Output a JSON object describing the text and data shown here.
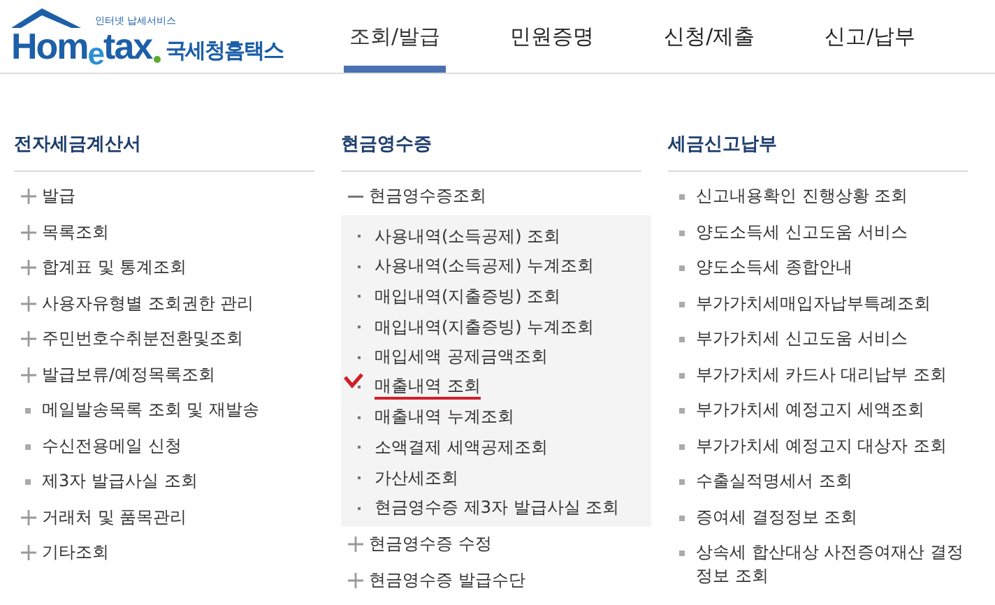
{
  "logo": {
    "tagline": "인터넷 납세서비스",
    "wordmark": "Hom$_{e}$tax",
    "name": "국세청홈택스"
  },
  "nav": [
    {
      "label": "조회/발급",
      "selected": true
    },
    {
      "label": "민원증명",
      "selected": false
    },
    {
      "label": "신청/제출",
      "selected": false
    },
    {
      "label": "신고/납부",
      "selected": false
    }
  ],
  "columns": [
    {
      "title": "전자세금계산서",
      "items": [
        {
          "kind": "plus",
          "label": "발급"
        },
        {
          "kind": "plus",
          "label": "목록조회"
        },
        {
          "kind": "plus",
          "label": "합계표 및 통계조회"
        },
        {
          "kind": "plus",
          "label": "사용자유형별 조회권한 관리"
        },
        {
          "kind": "plus",
          "label": "주민번호수취분전환및조회"
        },
        {
          "kind": "plus",
          "label": "발급보류/예정목록조회"
        },
        {
          "kind": "bullet",
          "label": "메일발송목록 조회 및 재발송"
        },
        {
          "kind": "bullet",
          "label": "수신전용메일 신청"
        },
        {
          "kind": "bullet",
          "label": "제3자 발급사실 조회"
        },
        {
          "kind": "plus",
          "label": "거래처 및 품목관리"
        },
        {
          "kind": "plus",
          "label": "기타조회"
        }
      ]
    },
    {
      "title": "현금영수증",
      "items": [
        {
          "kind": "minus",
          "label": "현금영수증조회",
          "children": [
            {
              "label": "사용내역(소득공제) 조회",
              "marked": false
            },
            {
              "label": "사용내역(소득공제) 누계조회",
              "marked": false
            },
            {
              "label": "매입내역(지출증빙) 조회",
              "marked": false
            },
            {
              "label": "매입내역(지출증빙) 누계조회",
              "marked": false
            },
            {
              "label": "매입세액 공제금액조회",
              "marked": false
            },
            {
              "label": "매출내역 조회",
              "marked": true
            },
            {
              "label": "매출내역 누계조회",
              "marked": false
            },
            {
              "label": "소액결제 세액공제조회",
              "marked": false
            },
            {
              "label": "가산세조회",
              "marked": false
            },
            {
              "label": "현금영수증 제3자 발급사실 조회",
              "marked": false
            }
          ]
        },
        {
          "kind": "plus",
          "label": "현금영수증 수정"
        },
        {
          "kind": "plus",
          "label": "현금영수증 발급수단"
        }
      ]
    },
    {
      "title": "세금신고납부",
      "items": [
        {
          "kind": "bullet",
          "label": "신고내용확인 진행상황 조회"
        },
        {
          "kind": "bullet",
          "label": "양도소득세 신고도움 서비스"
        },
        {
          "kind": "bullet",
          "label": "양도소득세 종합안내"
        },
        {
          "kind": "bullet",
          "label": "부가가치세매입자납부특례조회"
        },
        {
          "kind": "bullet",
          "label": "부가가치세 신고도움 서비스"
        },
        {
          "kind": "bullet",
          "label": "부가가치세 카드사 대리납부 조회"
        },
        {
          "kind": "bullet",
          "label": "부가가치세 예정고지 세액조회"
        },
        {
          "kind": "bullet",
          "label": "부가가치세 예정고지 대상자 조회"
        },
        {
          "kind": "bullet",
          "label": "수출실적명세서 조회"
        },
        {
          "kind": "bullet",
          "label": "증여세 결정정보 조회"
        },
        {
          "kind": "bullet",
          "label": "상속세 합산대상 사전증여재산 결정정보 조회"
        }
      ]
    }
  ]
}
